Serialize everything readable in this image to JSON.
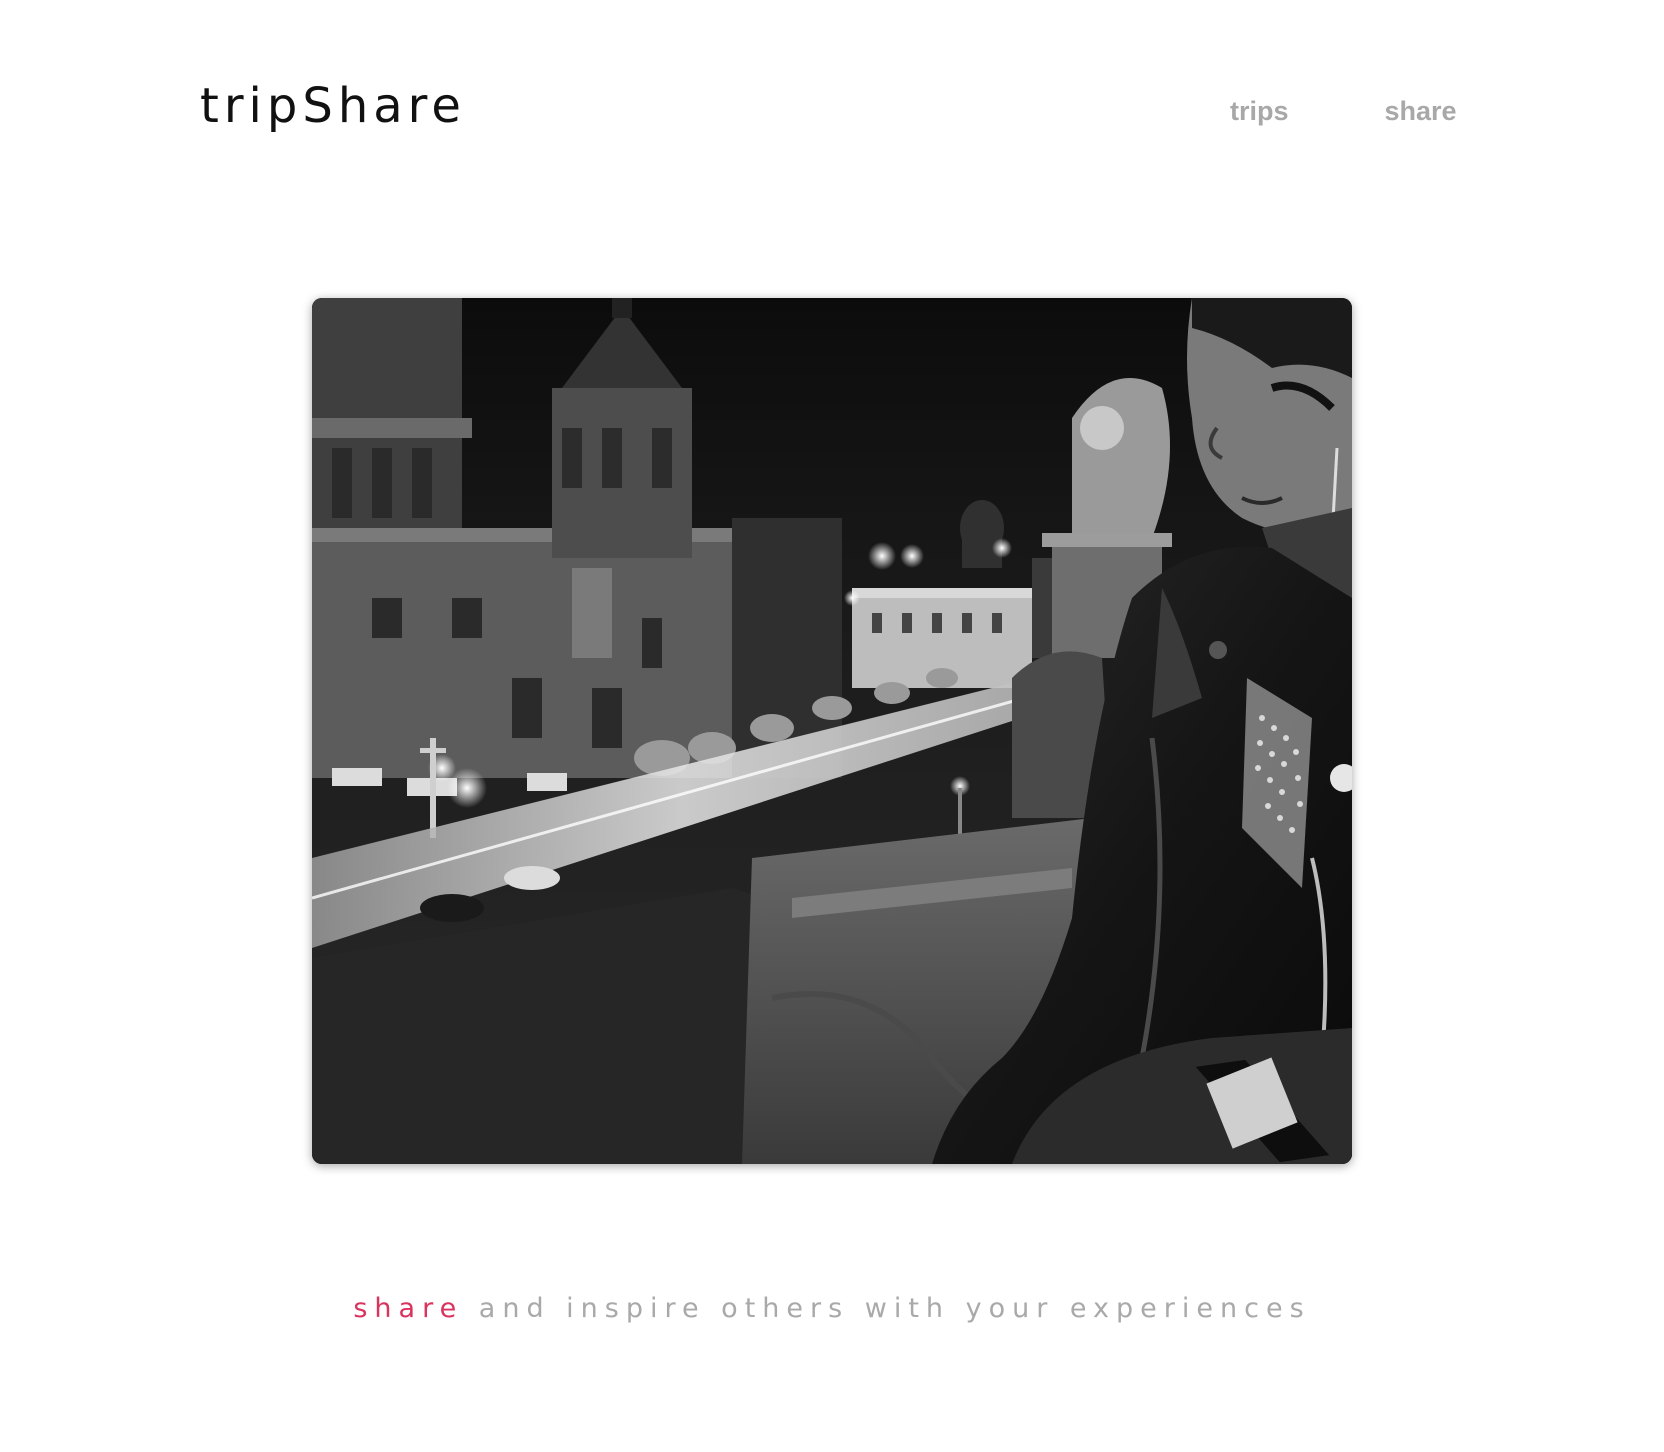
{
  "header": {
    "brand": "tripShare",
    "nav": [
      {
        "label": "trips"
      },
      {
        "label": "share"
      }
    ]
  },
  "hero": {
    "image_description_icon": "city-night-photo"
  },
  "tagline": {
    "accent_word": "share",
    "rest": " and inspire others with your experiences"
  },
  "colors": {
    "accent": "#d9335e",
    "nav": "#a8a8a8",
    "brand": "#111111"
  }
}
